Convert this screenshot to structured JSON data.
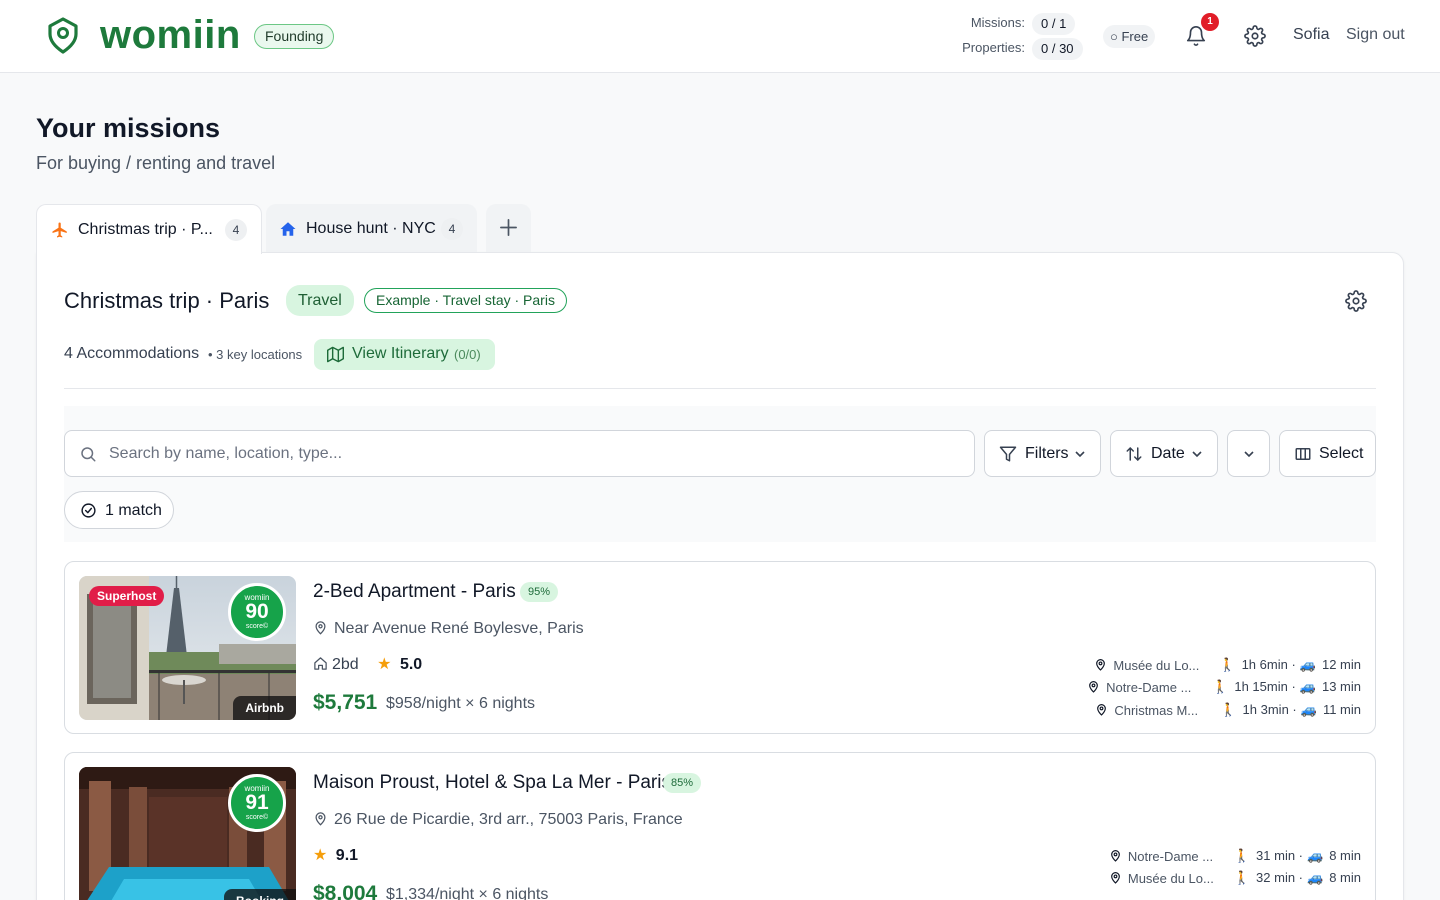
{
  "header": {
    "brand": "womiin",
    "plan_badge": "Founding",
    "missions_label": "Missions:",
    "missions_value": "0 / 1",
    "properties_label": "Properties:",
    "properties_value": "0 / 30",
    "tier": "○ Free",
    "notification_count": "1",
    "user_name": "Sofia",
    "sign_out": "Sign out",
    "brand_color": "#1e7a3c"
  },
  "page": {
    "title": "Your missions",
    "subtitle": "For buying / renting and travel"
  },
  "tabs": [
    {
      "label": "Christmas trip · P...",
      "count": "4",
      "icon": "airplane-icon",
      "active": true
    },
    {
      "label": "House hunt · NYC",
      "count": "4",
      "icon": "house-icon",
      "active": false
    }
  ],
  "mission": {
    "title": "Christmas trip · Paris",
    "type_tag": "Travel",
    "example_tag": "Example · Travel stay · Paris",
    "accommodations": "4 Accommodations",
    "key_locations": "• 3 key locations",
    "itinerary_label": "View Itinerary",
    "itinerary_count": "(0/0)"
  },
  "toolbar": {
    "search_placeholder": "Search by name, location, type...",
    "filters_label": "Filters",
    "sort_label": "Date",
    "select_label": "Select",
    "match_label": "1 match"
  },
  "listings": [
    {
      "title": "2-Bed Apartment - Paris",
      "match_pct": "95%",
      "address": "Near Avenue René Boylesve, Paris",
      "beds": "2bd",
      "rating": "5.0",
      "price": "$5,751",
      "per_night": "$958/night × 6 nights",
      "badge": "Superhost",
      "source": "Airbnb",
      "score_top": "womiin",
      "score": "90",
      "score_bottom": "score©",
      "locations": [
        {
          "name": "Musée du Lo...",
          "walk": "1h 6min ·",
          "drive": "12 min"
        },
        {
          "name": "Notre-Dame ...",
          "walk": "1h 15min ·",
          "drive": "13 min"
        },
        {
          "name": "Christmas M...",
          "walk": "1h 3min ·",
          "drive": "11 min"
        }
      ]
    },
    {
      "title": "Maison Proust, Hotel & Spa La Mer - Paris",
      "match_pct": "85%",
      "address": "26 Rue de Picardie, 3rd arr., 75003 Paris, France",
      "rating": "9.1",
      "price": "$8,004",
      "per_night": "$1,334/night × 6 nights",
      "source": "Booking",
      "score_top": "womiin",
      "score": "91",
      "score_bottom": "score©",
      "locations": [
        {
          "name": "Notre-Dame ...",
          "walk": "31 min ·",
          "drive": "8 min"
        },
        {
          "name": "Musée du Lo...",
          "walk": "32 min ·",
          "drive": "8 min"
        }
      ]
    }
  ]
}
